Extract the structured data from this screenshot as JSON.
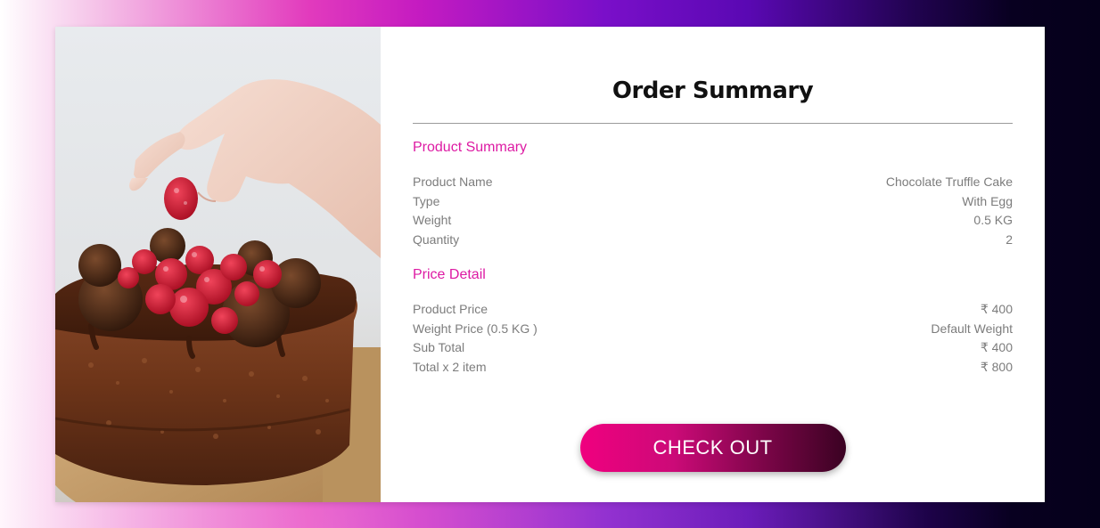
{
  "colors": {
    "accent": "#dd1aa3",
    "text_muted": "#7c7c7c",
    "title": "#111111",
    "button_gradient_start": "#f0007f",
    "button_gradient_end": "#3a0222"
  },
  "image": {
    "subject": "chocolate cake with raspberries and truffles, hand placing a raspberry"
  },
  "summary": {
    "title": "Order Summary",
    "product_section_title": "Product Summary",
    "product_rows": [
      {
        "label": "Product Name",
        "value": "Chocolate Truffle Cake"
      },
      {
        "label": "Type",
        "value": "With Egg"
      },
      {
        "label": "Weight",
        "value": "0.5 KG"
      },
      {
        "label": "Quantity",
        "value": "2"
      }
    ],
    "price_section_title": "Price Detail",
    "price_rows": [
      {
        "label": "Product Price",
        "value": "₹ 400"
      },
      {
        "label": "Weight Price (0.5 KG )",
        "value": "Default Weight"
      },
      {
        "label": "Sub Total",
        "value": "₹ 400"
      },
      {
        "label": "Total x 2 item",
        "value": "₹ 800"
      }
    ],
    "checkout_label": "CHECK OUT"
  }
}
